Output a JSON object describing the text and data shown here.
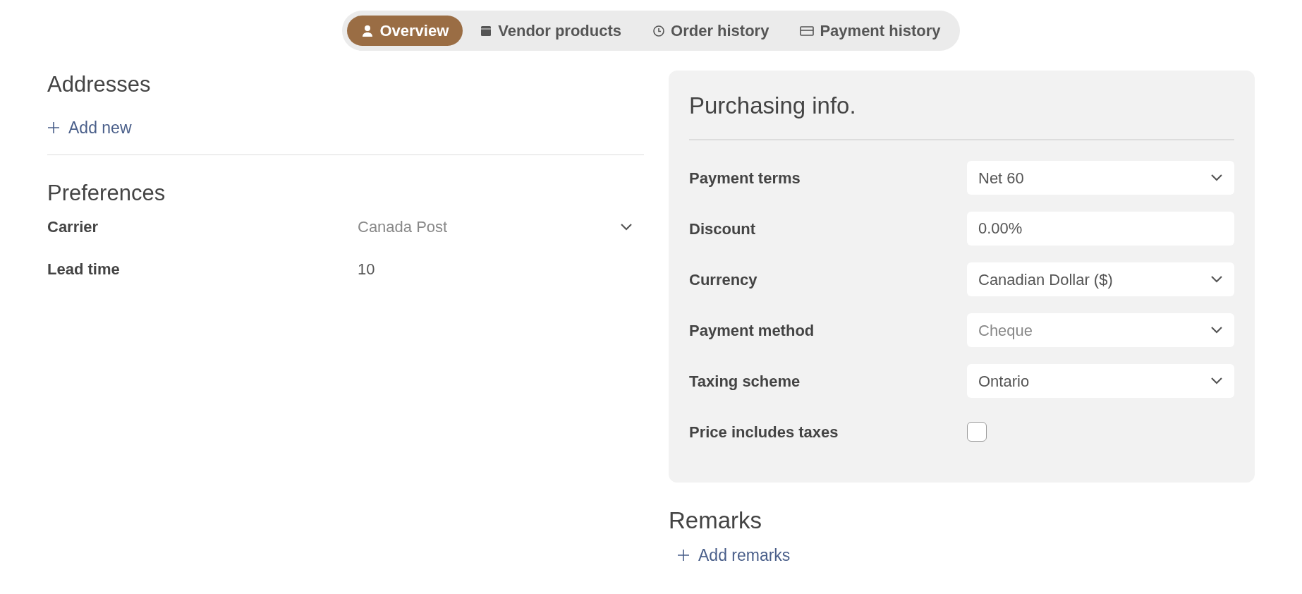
{
  "tabs": [
    {
      "label": "Overview",
      "kind": "person",
      "selected": true
    },
    {
      "label": "Vendor products",
      "kind": "box",
      "selected": false
    },
    {
      "label": "Order history",
      "kind": "clock",
      "selected": false
    },
    {
      "label": "Payment history",
      "kind": "card",
      "selected": false
    }
  ],
  "addresses": {
    "title": "Addresses",
    "add_label": "Add new"
  },
  "preferences": {
    "title": "Preferences",
    "rows": [
      {
        "label": "Carrier",
        "kind": "select",
        "placeholder": "Canada Post"
      },
      {
        "label": "Lead time",
        "kind": "input",
        "value": "10"
      }
    ]
  },
  "purchasing": {
    "title": "Purchasing info.",
    "rows": [
      {
        "label": "Payment terms",
        "kind": "select",
        "value": "Net 60"
      },
      {
        "label": "Discount",
        "kind": "input",
        "value": "0.00%"
      },
      {
        "label": "Currency",
        "kind": "select",
        "value": "Canadian Dollar ($)"
      },
      {
        "label": "Payment method",
        "kind": "select",
        "placeholder": "Cheque"
      },
      {
        "label": "Taxing scheme",
        "kind": "select",
        "value": "Ontario"
      },
      {
        "label": "Price includes taxes",
        "kind": "checkbox",
        "checked": false
      }
    ]
  },
  "remarks": {
    "title": "Remarks",
    "add_label": "Add remarks"
  }
}
